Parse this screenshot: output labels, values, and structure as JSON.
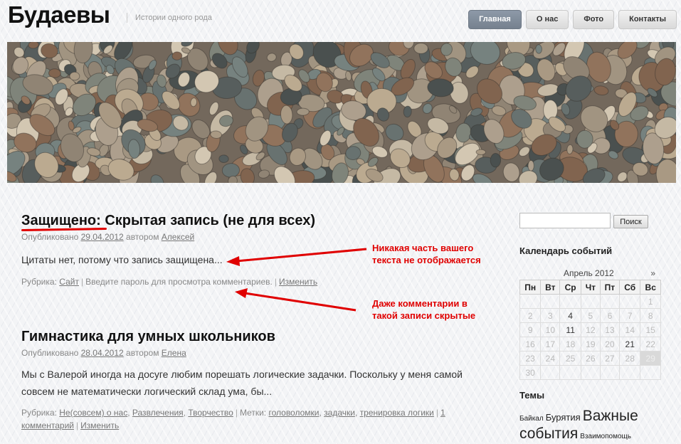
{
  "site": {
    "title": "Будаевы",
    "description": "Истории одного рода"
  },
  "nav": [
    {
      "label": "Главная",
      "active": true
    },
    {
      "label": "О нас",
      "active": false
    },
    {
      "label": "Фото",
      "active": false
    },
    {
      "label": "Контакты",
      "active": false
    }
  ],
  "posts": [
    {
      "title": "Защищено: Скрытая запись (не для всех)",
      "meta": {
        "published_label": "Опубликовано",
        "date": "29.04.2012",
        "author_label": "автором",
        "author": "Алексей"
      },
      "excerpt": "Цитаты нет, потому что запись защищена...",
      "footer": {
        "rubric_label": "Рубрика:",
        "rubric": "Сайт",
        "password_note": "Введите пароль для просмотра комментариев.",
        "edit": "Изменить"
      }
    },
    {
      "title": "Гимнастика для умных школьников",
      "meta": {
        "published_label": "Опубликовано",
        "date": "28.04.2012",
        "author_label": "автором",
        "author": "Елена"
      },
      "excerpt": "Мы с Валерой иногда на досуге любим порешать логические задачки. Поскольку у меня самой совсем не математически логический склад ума, бы...",
      "footer": {
        "rubric_label": "Рубрика:",
        "rubrics": [
          "Не(совсем) о нас",
          "Развлечения",
          "Творчество"
        ],
        "tags_label": "Метки:",
        "tags": [
          "головоломки",
          "задачки",
          "тренировка логики"
        ],
        "comments": "1 комментарий",
        "edit": "Изменить"
      }
    }
  ],
  "annotations": {
    "note1": [
      "Никакая часть вашего",
      "текста не отображается"
    ],
    "note2": [
      "Даже комментарии в",
      "такой записи скрытые"
    ],
    "color": "#e00000"
  },
  "sidebar": {
    "search": {
      "value": "",
      "button": "Поиск"
    },
    "calendar": {
      "title": "Календарь событий",
      "month": "Апрель 2012",
      "next": "»",
      "weekdays": [
        "Пн",
        "Вт",
        "Ср",
        "Чт",
        "Пт",
        "Сб",
        "Вс"
      ],
      "weeks": [
        [
          "",
          "",
          "",
          "",
          "",
          "",
          "1"
        ],
        [
          "2",
          "3",
          "4",
          "5",
          "6",
          "7",
          "8"
        ],
        [
          "9",
          "10",
          "11",
          "12",
          "13",
          "14",
          "15"
        ],
        [
          "16",
          "17",
          "18",
          "19",
          "20",
          "21",
          "22"
        ],
        [
          "23",
          "24",
          "25",
          "26",
          "27",
          "28",
          "29"
        ],
        [
          "30",
          "",
          "",
          "",
          "",
          "",
          ""
        ]
      ],
      "days_with_posts": [
        "4",
        "11",
        "21"
      ],
      "today": "29"
    },
    "topics": {
      "title": "Темы",
      "tags": [
        {
          "label": "Байкал",
          "weight": 1
        },
        {
          "label": "Бурятия",
          "weight": 2
        },
        {
          "label": "Важные события",
          "weight": 4
        },
        {
          "label": "Взаимопомощь",
          "weight": 1
        }
      ]
    }
  }
}
